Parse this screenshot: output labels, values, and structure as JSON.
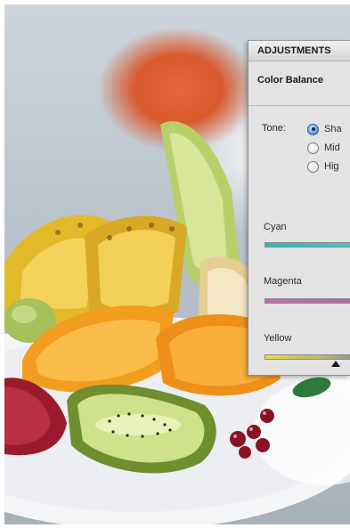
{
  "panel": {
    "title": "ADJUSTMENTS",
    "subtitle": "Color Balance",
    "tone_label": "Tone:",
    "tones": [
      {
        "label": "Sha",
        "selected": true
      },
      {
        "label": "Mid",
        "selected": false
      },
      {
        "label": "Hig",
        "selected": false
      }
    ],
    "sliders": [
      {
        "label": "Cyan",
        "color": "#3bbdb8"
      },
      {
        "label": "Magenta",
        "color": "#bf6ab1"
      },
      {
        "label": "Yellow",
        "color": "#e8e23a"
      }
    ]
  },
  "photo": {
    "subject": "fruit plate"
  }
}
